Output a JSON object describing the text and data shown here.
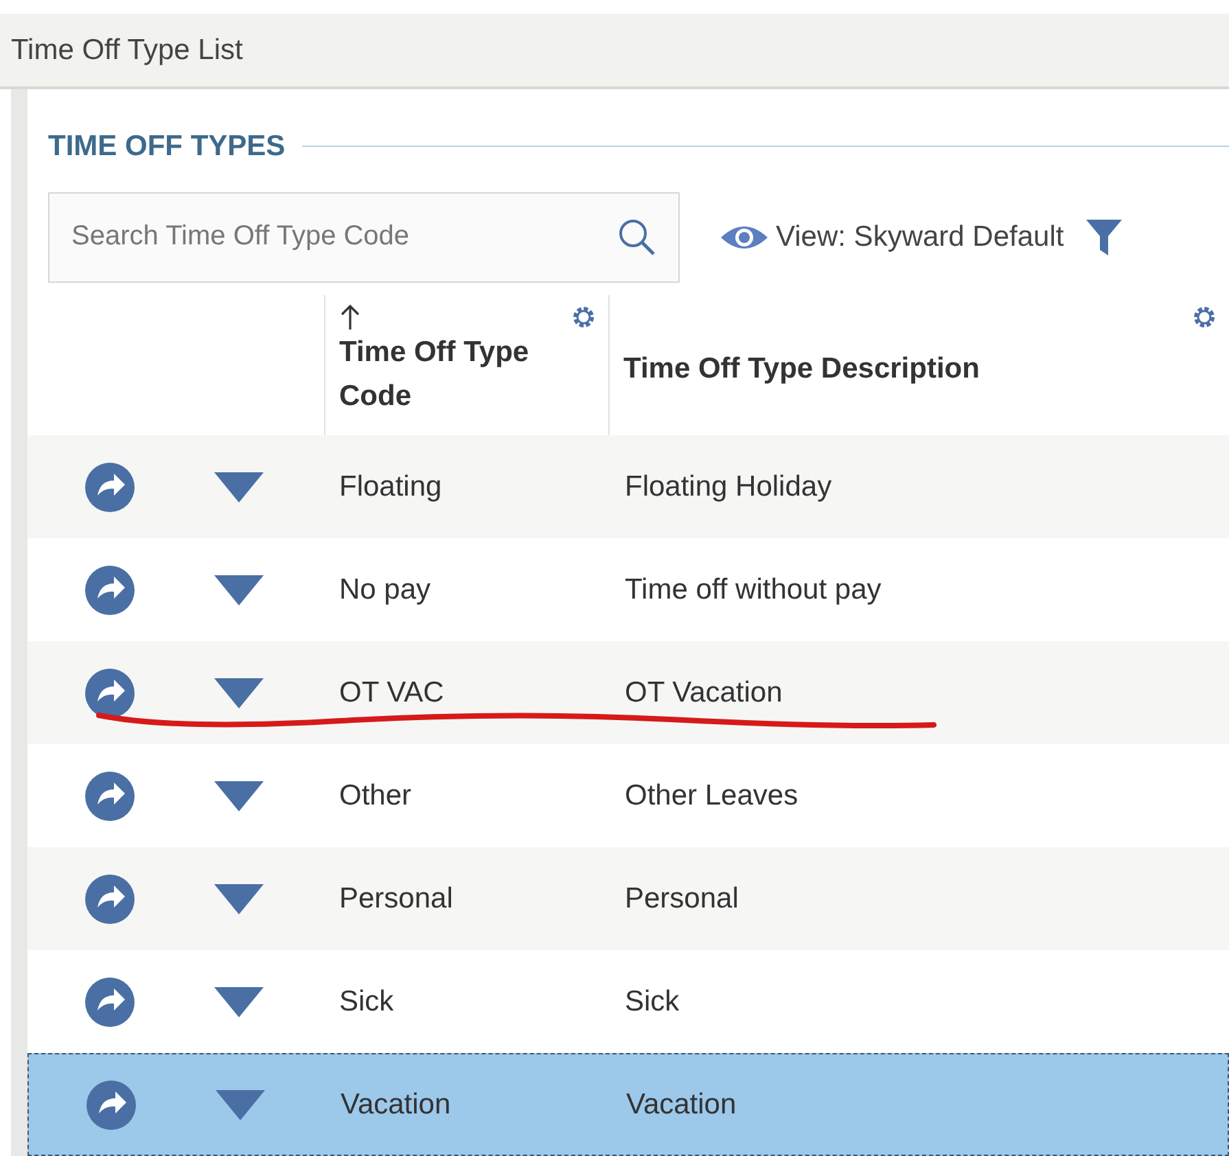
{
  "window": {
    "title": "Time Off Type List"
  },
  "section": {
    "title": "TIME OFF TYPES"
  },
  "search": {
    "placeholder": "Search Time Off Type Code"
  },
  "view": {
    "label": "View: Skyward Default"
  },
  "table": {
    "columns": [
      {
        "label": "Time Off Type Code",
        "sorted": true
      },
      {
        "label": "Time Off Type Description",
        "sorted": false
      }
    ],
    "rows": [
      {
        "code": "Floating",
        "description": "Floating Holiday",
        "selected": false,
        "crossed_out": false
      },
      {
        "code": "No pay",
        "description": "Time off without pay",
        "selected": false,
        "crossed_out": false
      },
      {
        "code": "OT VAC",
        "description": "OT Vacation",
        "selected": false,
        "crossed_out": true
      },
      {
        "code": "Other",
        "description": "Other Leaves",
        "selected": false,
        "crossed_out": false
      },
      {
        "code": "Personal",
        "description": "Personal",
        "selected": false,
        "crossed_out": false
      },
      {
        "code": "Sick",
        "description": "Sick",
        "selected": false,
        "crossed_out": false
      },
      {
        "code": "Vacation",
        "description": "Vacation",
        "selected": true,
        "crossed_out": false
      }
    ]
  }
}
